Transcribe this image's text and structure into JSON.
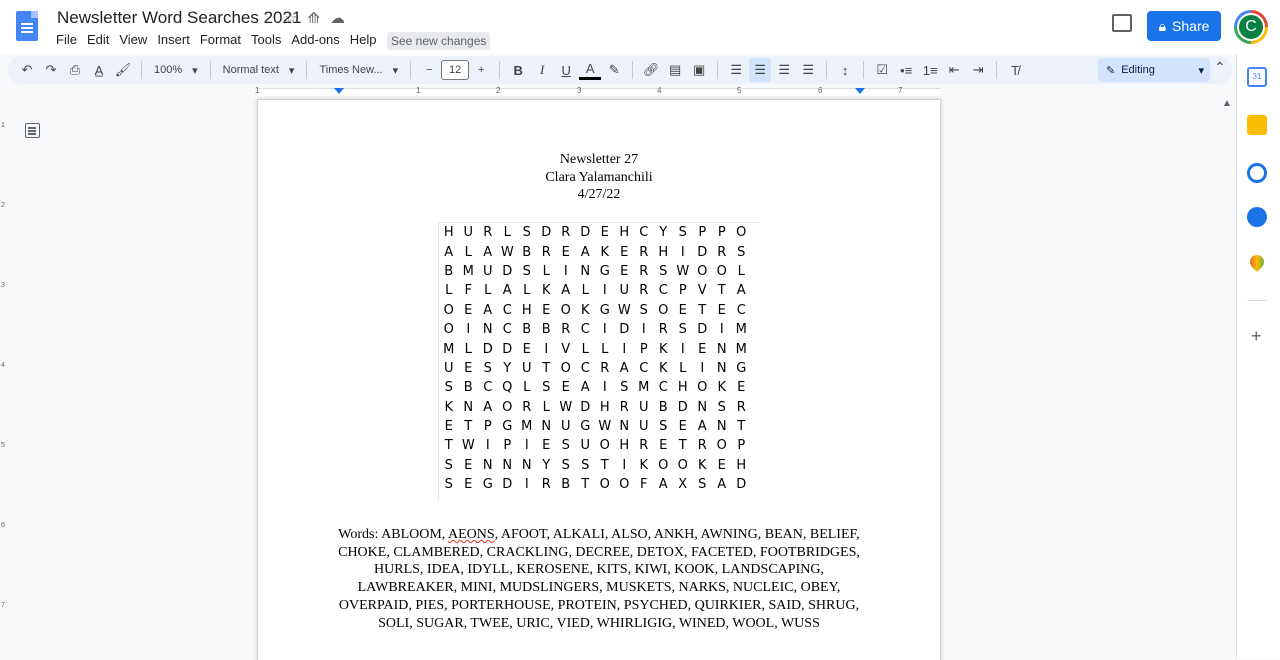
{
  "app": {
    "doc_title": "Newsletter Word Searches 2021",
    "menu": [
      "File",
      "Edit",
      "View",
      "Insert",
      "Format",
      "Tools",
      "Add-ons",
      "Help"
    ],
    "see_changes": "See new changes",
    "share_label": "Share",
    "avatar_initial": "C"
  },
  "toolbar": {
    "zoom": "100%",
    "style": "Normal text",
    "font": "Times New...",
    "font_size": "12",
    "bold": "B",
    "italic": "I",
    "underline": "U",
    "text_color": "A",
    "minus": "−",
    "plus": "+",
    "mode": "Editing"
  },
  "ruler": {
    "numbers": [
      "1",
      "1",
      "2",
      "3",
      "4",
      "5",
      "6",
      "7"
    ]
  },
  "document": {
    "header_lines": [
      "Newsletter 27",
      "Clara Yalamanchili",
      "4/27/22"
    ],
    "grid": [
      "HURLSDRDEHCYSPPO",
      "ALAWBREAKERHIDRS",
      "BMUDSLINGERSWOOL",
      "LFLALKALIURCPVTA",
      "OEACHEOKGWSOETEC",
      "OINCBBRCIDIRSDIM",
      "MLDDEIVLLIPKIENM",
      "UESYUTOCRACKLING",
      "SBCQLSEAISMCHOKE",
      "KNAORLWDHRUBDNSR",
      "ETPGMNUGWNUSEANT",
      "TWIPIESUOHRETROP",
      "SENNNYSSTIKOOKEH",
      "SEGDIRBTOOFAXSAD"
    ],
    "words_prefix": "Words: ABLOOM, ",
    "words_flagged": "AEONS",
    "words_rest": ", AFOOT, ALKALI, ALSO, ANKH, AWNING, BEAN, BELIEF, CHOKE, CLAMBERED, CRACKLING, DECREE, DETOX, FACETED, FOOTBRIDGES, HURLS, IDEA, IDYLL, KEROSENE, KITS, KIWI, KOOK, LANDSCAPING, LAWBREAKER, MINI, MUDSLINGERS, MUSKETS, NARKS, NUCLEIC, OBEY, OVERPAID, PIES, PORTERHOUSE, PROTEIN, PSYCHED, QUIRKIER, SAID, SHRUG, SOLI, SUGAR, TWEE, URIC, VIED, WHIRLIGIG, WINED, WOOL, WUSS"
  },
  "colors": {
    "accent": "#1a73e8",
    "doc_icon": "#4285f4",
    "editing_bg": "#d3e3fd",
    "spell_error": "#d93025"
  }
}
